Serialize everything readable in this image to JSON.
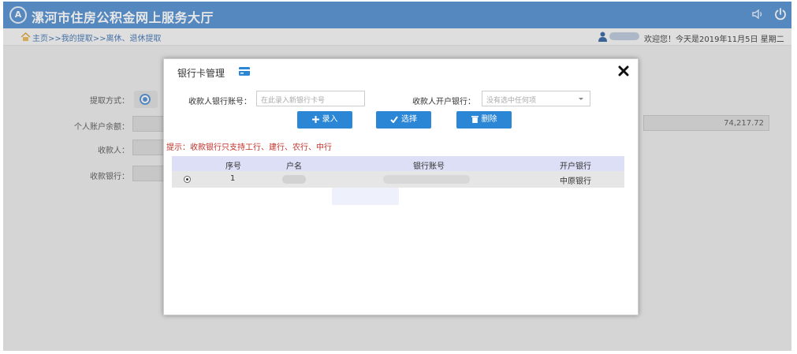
{
  "header": {
    "logo_text": "A",
    "title": "漯河市住房公积金网上服务大厅",
    "icons": [
      "speaker-icon",
      "power-icon"
    ]
  },
  "subbar": {
    "breadcrumb": "主页>>我的提取>>离休、退休提取",
    "welcome": "欢迎您！今天是2019年11月5日 星期二"
  },
  "form": {
    "withdraw_method_label": "提取方式：",
    "balance_label": "个人账户余额：",
    "payee_label": "收款人：",
    "payee_bank_label": "收款银行：",
    "balance_value": "74,217.72"
  },
  "modal": {
    "title": "银行卡管理",
    "account_label": "收款人银行账号：",
    "account_placeholder": "在此录入新银行卡号",
    "bank_label": "收款人开户银行：",
    "bank_selected": "没有选中任何项",
    "buttons": {
      "enter": "录入",
      "select": "选择",
      "delete": "删除"
    },
    "hint": "提示：收款银行只支持工行、建行、农行、中行",
    "table": {
      "headers": [
        "序号",
        "户名",
        "银行账号",
        "开户银行"
      ],
      "rows": [
        {
          "index": "1",
          "bank": "中原银行"
        }
      ]
    }
  },
  "colors": {
    "header_bg": "#4e8ccf",
    "button_bg": "#2c86d6",
    "hint": "#c0312a",
    "table_head": "#dcdff5"
  }
}
